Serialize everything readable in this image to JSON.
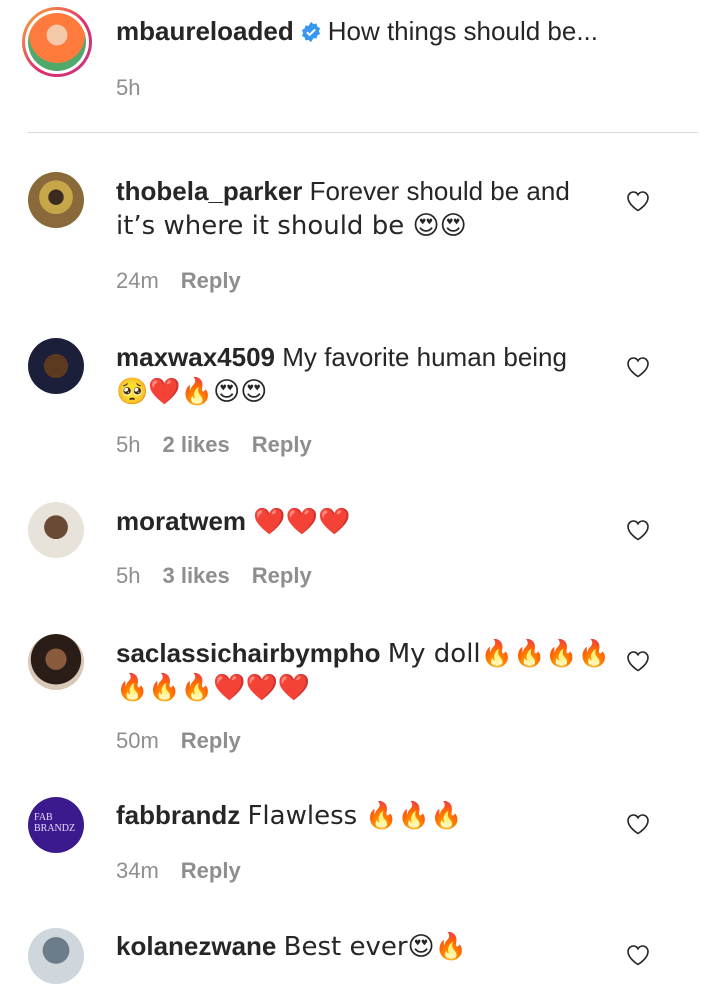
{
  "caption": {
    "username": "mbaureloaded",
    "text": "How things should be...",
    "time": "5h",
    "verified_icon": "verified-badge-icon"
  },
  "comments": [
    {
      "username": "thobela_parker",
      "line1": "Forever should be and",
      "line2": "it’s where it should be 😍😍",
      "time": "24m",
      "likes": "",
      "reply": "Reply"
    },
    {
      "username": "maxwax4509",
      "line1": "My favorite human being",
      "line2": "🥺❤️🔥😍😍",
      "time": "5h",
      "likes": "2 likes",
      "reply": "Reply"
    },
    {
      "username": "moratwem",
      "line1": "❤️❤️❤️",
      "line2": "",
      "time": "5h",
      "likes": "3 likes",
      "reply": "Reply"
    },
    {
      "username": "saclassichairbympho",
      "line1": "My doll🔥🔥🔥🔥",
      "line2": "🔥🔥🔥❤️❤️❤️",
      "time": "50m",
      "likes": "",
      "reply": "Reply"
    },
    {
      "username": "fabbrandz",
      "line1": "Flawless 🔥🔥🔥",
      "line2": "",
      "time": "34m",
      "likes": "",
      "reply": "Reply",
      "avatar_text": "FAB BRANDZ"
    },
    {
      "username": "kolanezwane",
      "line1": "Best ever😍🔥",
      "line2": "",
      "time": "",
      "likes": "",
      "reply": ""
    }
  ],
  "colors": {
    "text": "#262626",
    "meta": "#8e8e8e",
    "divider": "#dbdbdb",
    "verified": "#3897f0"
  }
}
